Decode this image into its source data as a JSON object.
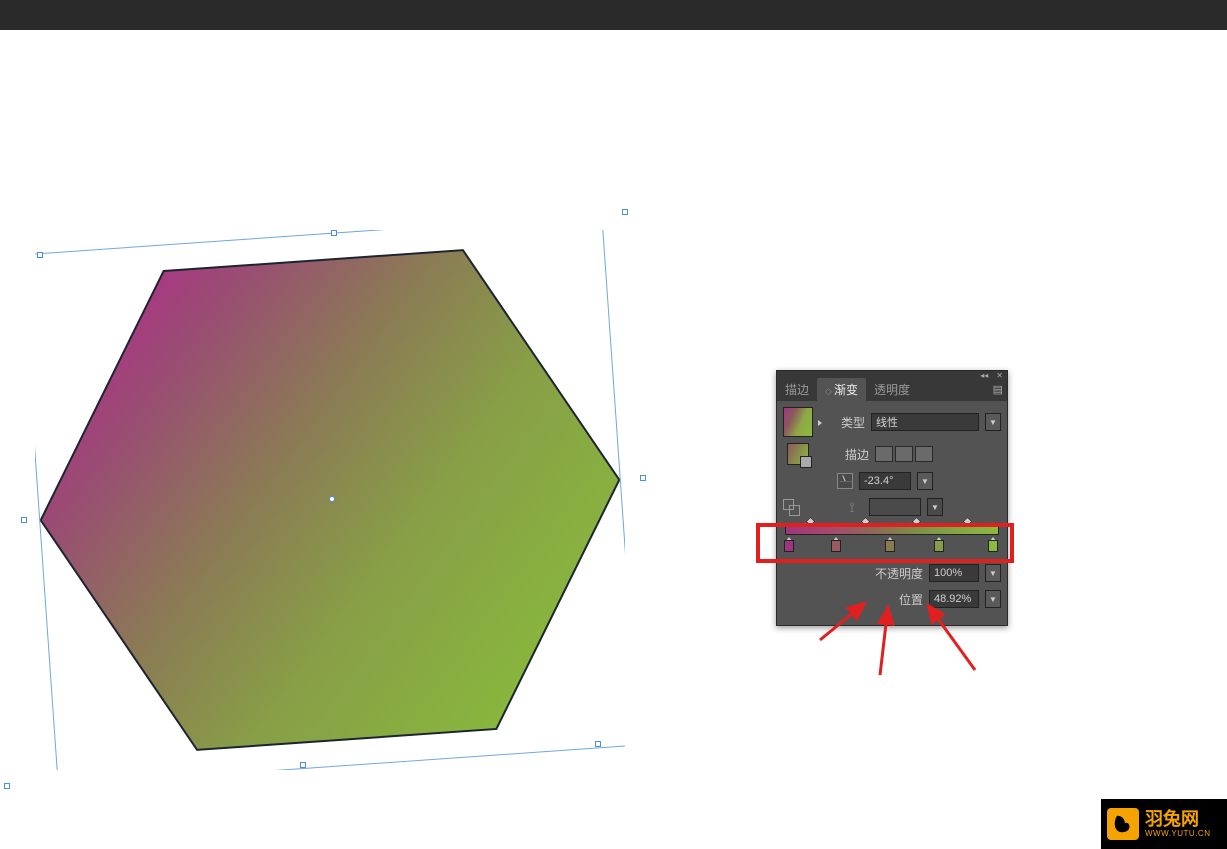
{
  "panel": {
    "tabs": {
      "stroke": "描边",
      "gradient": "渐变",
      "transparency": "透明度"
    },
    "type_label": "类型",
    "type_value": "线性",
    "stroke_label": "描边",
    "angle_value": "-23.4°",
    "opacity_label": "不透明度",
    "opacity_value": "100%",
    "position_label": "位置",
    "position_value": "48.92%"
  },
  "watermark": {
    "cn": "羽兔网",
    "en": "WWW.YUTU.CN"
  },
  "chart_data": {
    "type": "gradient",
    "gradient_type": "linear",
    "angle_deg": -23.4,
    "stops": [
      {
        "position_pct": 0,
        "color": "#a0357f"
      },
      {
        "position_pct": 24,
        "color": "#a24f66"
      },
      {
        "position_pct": 48.92,
        "color": "#8a7a50"
      },
      {
        "position_pct": 72,
        "color": "#859d45"
      },
      {
        "position_pct": 97,
        "color": "#8bbb3e"
      }
    ],
    "selected_stop_opacity_pct": 100,
    "selected_stop_position_pct": 48.92
  }
}
